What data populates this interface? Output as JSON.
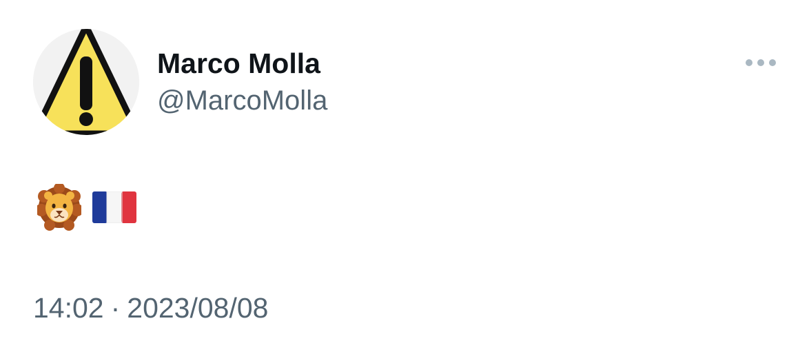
{
  "user": {
    "display_name": "Marco Molla",
    "handle": "@MarcoMolla",
    "avatar_icon": "warning-sign-icon",
    "avatar_colors": {
      "fill": "#f7e15a",
      "border": "#111111",
      "background": "#f2f2f2"
    }
  },
  "header": {
    "more_icon": "more-options-icon",
    "more_color": "#aab8c2"
  },
  "tweet": {
    "content_icons": [
      "lion-face-icon",
      "france-flag-icon"
    ]
  },
  "meta": {
    "time": "14:02",
    "separator": "·",
    "date": "2023/08/08"
  },
  "colors": {
    "name_text": "#0f1419",
    "secondary_text": "#536471",
    "background": "#ffffff"
  }
}
